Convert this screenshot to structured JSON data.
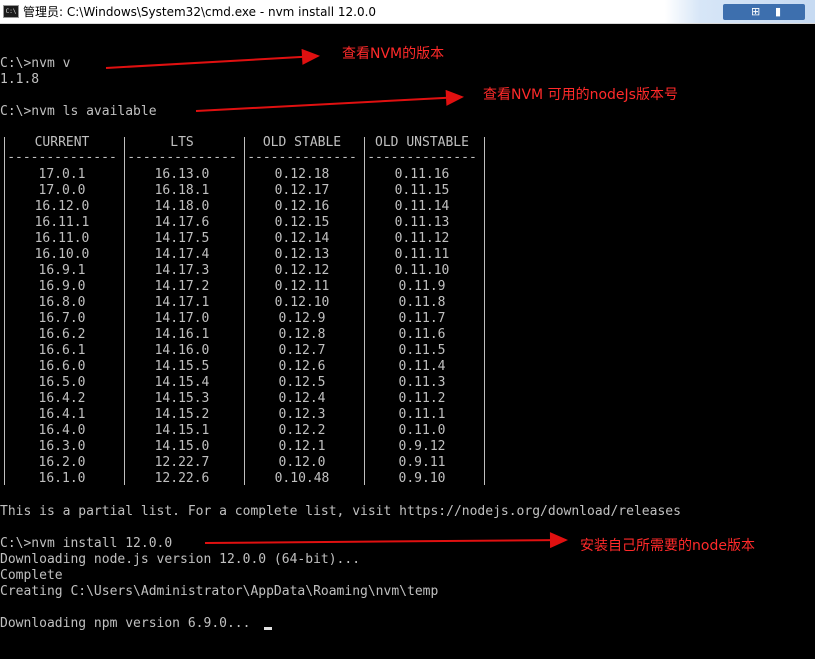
{
  "window": {
    "title": "管理员: C:\\Windows\\System32\\cmd.exe - nvm  install 12.0.0",
    "app_icon_text": "C:\\",
    "icons": [
      "cmd-app-icon",
      "pin-icon",
      "signal-icon"
    ]
  },
  "console": {
    "cmd_nvm_v": "C:\\>nvm v",
    "nvm_version": "1.1.8",
    "cmd_ls_available": "C:\\>nvm ls available",
    "table": {
      "headers": [
        "CURRENT",
        "LTS",
        "OLD STABLE",
        "OLD UNSTABLE"
      ],
      "separator": "--------------",
      "rows": [
        [
          "17.0.1",
          "16.13.0",
          "0.12.18",
          "0.11.16"
        ],
        [
          "17.0.0",
          "16.18.1",
          "0.12.17",
          "0.11.15"
        ],
        [
          "16.12.0",
          "14.18.0",
          "0.12.16",
          "0.11.14"
        ],
        [
          "16.11.1",
          "14.17.6",
          "0.12.15",
          "0.11.13"
        ],
        [
          "16.11.0",
          "14.17.5",
          "0.12.14",
          "0.11.12"
        ],
        [
          "16.10.0",
          "14.17.4",
          "0.12.13",
          "0.11.11"
        ],
        [
          "16.9.1",
          "14.17.3",
          "0.12.12",
          "0.11.10"
        ],
        [
          "16.9.0",
          "14.17.2",
          "0.12.11",
          "0.11.9"
        ],
        [
          "16.8.0",
          "14.17.1",
          "0.12.10",
          "0.11.8"
        ],
        [
          "16.7.0",
          "14.17.0",
          "0.12.9",
          "0.11.7"
        ],
        [
          "16.6.2",
          "14.16.1",
          "0.12.8",
          "0.11.6"
        ],
        [
          "16.6.1",
          "14.16.0",
          "0.12.7",
          "0.11.5"
        ],
        [
          "16.6.0",
          "14.15.5",
          "0.12.6",
          "0.11.4"
        ],
        [
          "16.5.0",
          "14.15.4",
          "0.12.5",
          "0.11.3"
        ],
        [
          "16.4.2",
          "14.15.3",
          "0.12.4",
          "0.11.2"
        ],
        [
          "16.4.1",
          "14.15.2",
          "0.12.3",
          "0.11.1"
        ],
        [
          "16.4.0",
          "14.15.1",
          "0.12.2",
          "0.11.0"
        ],
        [
          "16.3.0",
          "14.15.0",
          "0.12.1",
          "0.9.12"
        ],
        [
          "16.2.0",
          "12.22.7",
          "0.12.0",
          "0.9.11"
        ],
        [
          "16.1.0",
          "12.22.6",
          "0.10.48",
          "0.9.10"
        ]
      ]
    },
    "partial_list_note": "This is a partial list. For a complete list, visit https://nodejs.org/download/releases",
    "cmd_install": "C:\\>nvm install 12.0.0",
    "downloading_node": "Downloading node.js version 12.0.0 (64-bit)...",
    "complete": "Complete",
    "creating": "Creating C:\\Users\\Administrator\\AppData\\Roaming\\nvm\\temp",
    "downloading_npm": "Downloading npm version 6.9.0... "
  },
  "annotations": {
    "check_nvm_version": "查看NVM的版本",
    "check_available": "查看NVM 可用的nodeJs版本号",
    "install_needed": "安装自己所需要的node版本"
  },
  "colors": {
    "terminal_bg": "#000000",
    "terminal_text": "#c0c0c0",
    "annotation_red": "#ff2a2a",
    "systray_blue": "#3d6fae"
  }
}
